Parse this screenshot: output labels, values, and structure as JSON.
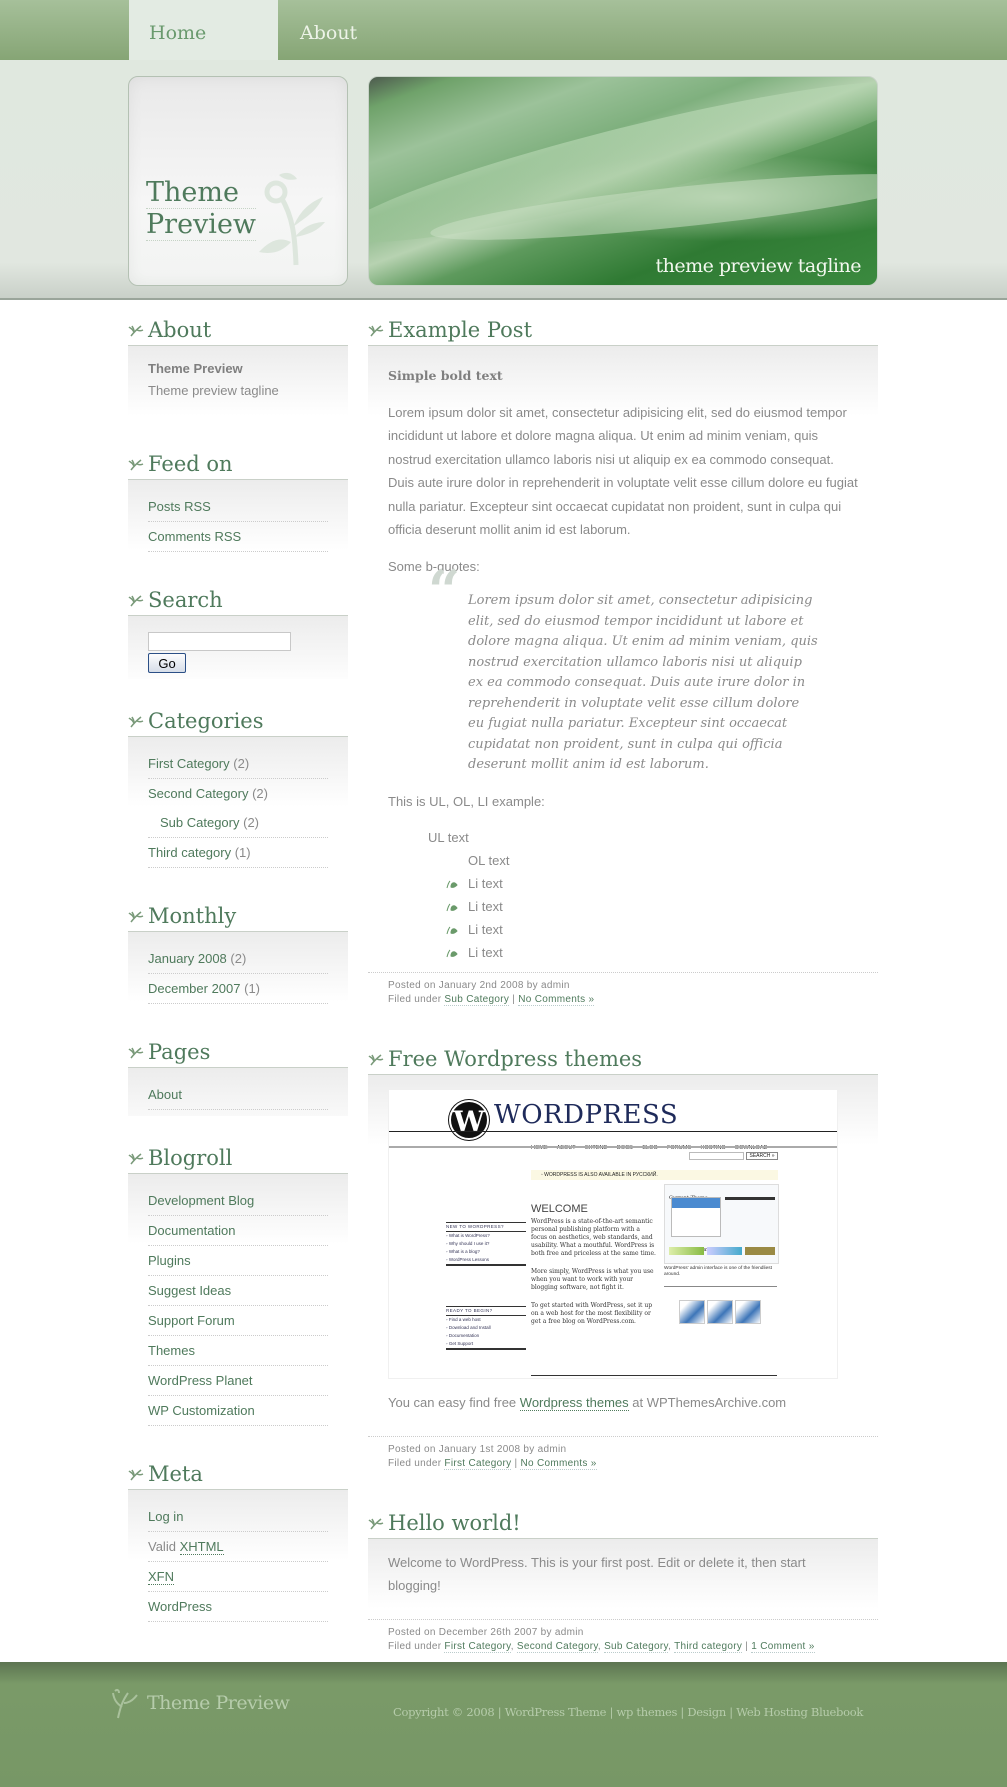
{
  "nav": {
    "tabs": [
      {
        "label": "Home",
        "active": true
      },
      {
        "label": "About",
        "active": false
      }
    ]
  },
  "header": {
    "logo_line1": "Theme",
    "logo_line2": "Preview",
    "tagline": "theme preview tagline"
  },
  "sidebar": {
    "about": {
      "title": "About",
      "name": "Theme Preview",
      "tagline": "Theme preview tagline"
    },
    "feed": {
      "title": "Feed on",
      "items": [
        "Posts RSS",
        "Comments RSS"
      ]
    },
    "search": {
      "title": "Search",
      "input_value": "",
      "button_label": "Go"
    },
    "categories": {
      "title": "Categories",
      "items": [
        {
          "label": "First Category",
          "count": "(2)"
        },
        {
          "label": "Second Category",
          "count": "(2)"
        },
        {
          "label": "Sub Category",
          "count": "(2)"
        },
        {
          "label": "Third category",
          "count": "(1)"
        }
      ]
    },
    "monthly": {
      "title": "Monthly",
      "items": [
        {
          "label": "January 2008",
          "count": "(2)"
        },
        {
          "label": "December 2007",
          "count": "(1)"
        }
      ]
    },
    "pages": {
      "title": "Pages",
      "items": [
        "About"
      ]
    },
    "blogroll": {
      "title": "Blogroll",
      "items": [
        "Development Blog",
        "Documentation",
        "Plugins",
        "Suggest Ideas",
        "Support Forum",
        "Themes",
        "WordPress Planet",
        "WP Customization"
      ]
    },
    "meta": {
      "title": "Meta",
      "login": "Log in",
      "valid_prefix": "Valid ",
      "xhtml": "XHTML",
      "xfn": "XFN",
      "wordpress": "WordPress"
    }
  },
  "posts": [
    {
      "title": "Example Post",
      "bold": "Simple bold text",
      "para": "Lorem ipsum dolor sit amet, consectetur adipisicing elit, sed do eiusmod tempor incididunt ut labore et dolore magna aliqua. Ut enim ad minim veniam, quis nostrud exercitation ullamco laboris nisi ut aliquip ex ea commodo consequat. Duis aute irure dolor in reprehenderit in voluptate velit esse cillum dolore eu fugiat nulla pariatur. Excepteur sint occaecat cupidatat non proident, sunt in culpa qui officia deserunt mollit anim id est laborum.",
      "bquote_label": "Some b-quotes:",
      "quote": "Lorem ipsum dolor sit amet, consectetur adipisicing elit, sed do eiusmod tempor incididunt ut labore et dolore magna aliqua. Ut enim ad minim veniam, quis nostrud exercitation ullamco laboris nisi ut aliquip ex ea commodo consequat. Duis aute irure dolor in reprehenderit in voluptate velit esse cillum dolore eu fugiat nulla pariatur. Excepteur sint occaecat cupidatat non proident, sunt in culpa qui officia deserunt mollit anim id est laborum.",
      "list_label": "This is UL, OL, LI example:",
      "ul_text": "UL text",
      "ol_text": "OL text",
      "li_items": [
        "Li text",
        "Li text",
        "Li text",
        "Li text"
      ],
      "posted": "Posted on January 2nd 2008 by admin",
      "filed_prefix": "Filed under ",
      "categories": [
        "Sub Category"
      ],
      "comments": "No Comments »"
    },
    {
      "title": "Free Wordpress themes",
      "text_before": "You can easy find free ",
      "link": "Wordpress themes",
      "text_after": " at WPThemesArchive.com",
      "posted": "Posted on January 1st 2008 by admin",
      "filed_prefix": "Filed under ",
      "categories": [
        "First Category"
      ],
      "comments": "No Comments »",
      "screenshot": {
        "logo_letter": "W",
        "wordmark": "WORDPRESS",
        "nav": "HOME ABOUT EXTEND DOCS BLOG FORUMS HOSTING DOWNLOAD",
        "search_btn": "SEARCH »",
        "notice": "◦ WORDPRESS IS ALSO AVAILABLE IN РУССКИЙ.",
        "welcome": "WELCOME",
        "intro": "WordPress is a state-of-the-art semantic personal publishing platform with a focus on aesthetics, web standards, and usability. What a mouthful. WordPress is both free and priceless at the same time.",
        "simply": "More simply, WordPress is what you use when you want to work with your blogging software, not fight it.",
        "get_started": "To get started with WordPress, set it up on a web host for the most flexibility or get a free blog on WordPress.com.",
        "new_heading": "NEW TO WORDPRESS?",
        "new_items": [
          "◦ What is WordPress?",
          "◦ Why should I use it?",
          "◦ What is a blog?",
          "◦ WordPress Lessons"
        ],
        "ready_heading": "READY TO BEGIN?",
        "ready_items": [
          "◦ Find a web host",
          "◦ Download and Install",
          "◦ Documentation",
          "◦ Get Support"
        ],
        "panel_current": "Current Theme",
        "panel_available": "Available Themes",
        "caption": "WordPress' admin interface is one of the friendliest around."
      }
    },
    {
      "title": "Hello world!",
      "para": "Welcome to WordPress. This is your first post. Edit or delete it, then start blogging!",
      "posted": "Posted on December 26th 2007 by admin",
      "filed_prefix": "Filed under ",
      "categories": [
        "First Category",
        "Second Category",
        "Sub Category",
        "Third category"
      ],
      "comments": "1 Comment »"
    }
  ],
  "footer": {
    "logo": "Theme Preview",
    "copyright": "Copyright © 2008",
    "links": [
      "WordPress Theme",
      "wp themes",
      "Design",
      "Web Hosting Bluebook"
    ]
  },
  "colors": {
    "accent": "#4f7a5c",
    "nav_bar": "#94b083",
    "footer": "#779766"
  }
}
